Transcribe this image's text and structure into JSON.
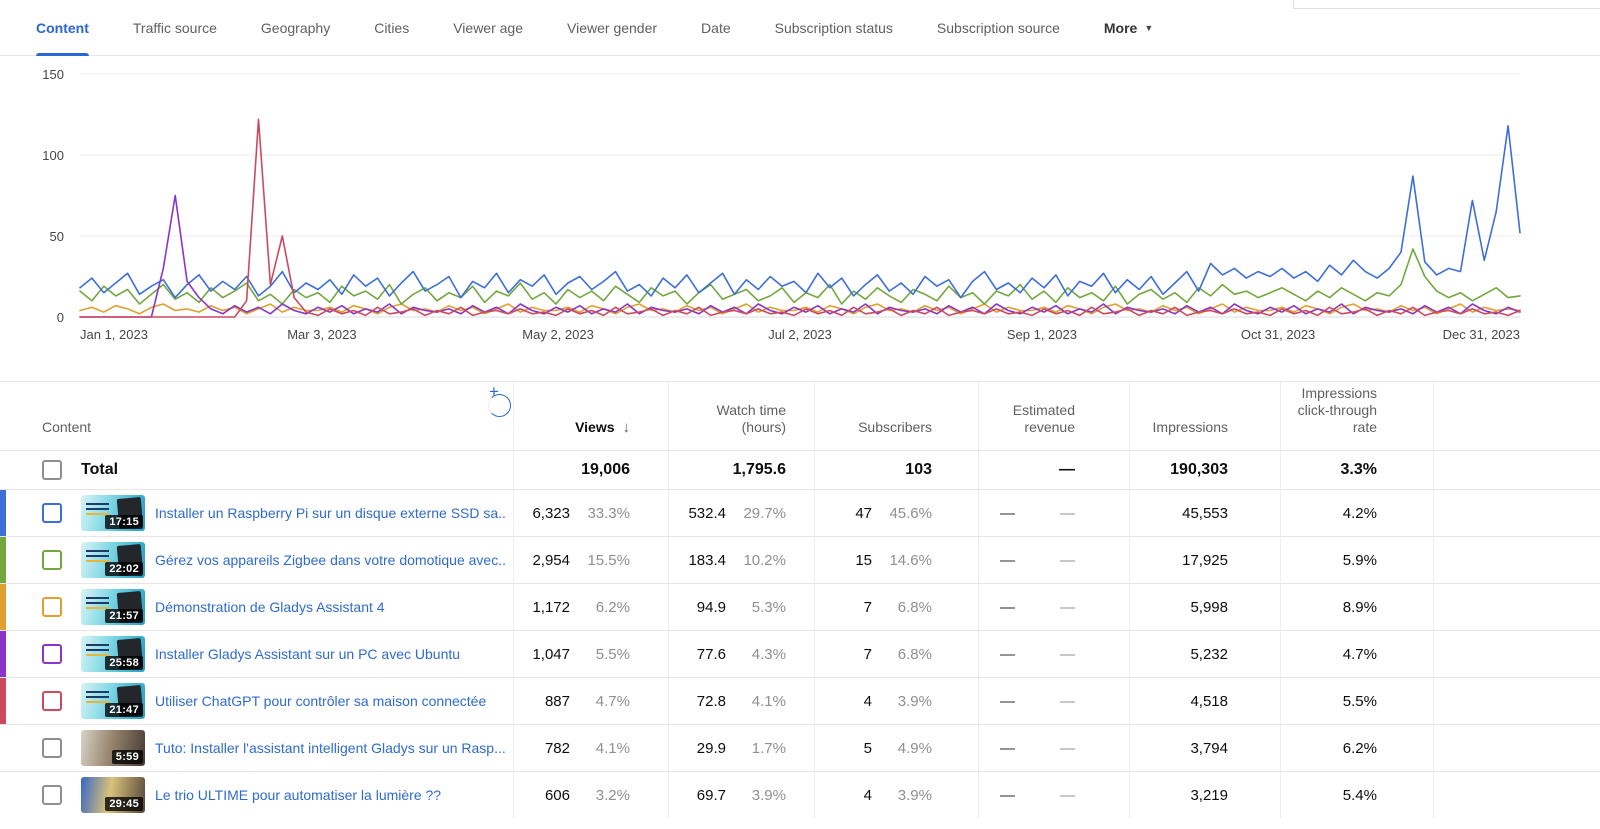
{
  "tabs": {
    "items": [
      {
        "label": "Content",
        "active": true
      },
      {
        "label": "Traffic source",
        "active": false
      },
      {
        "label": "Geography",
        "active": false
      },
      {
        "label": "Cities",
        "active": false
      },
      {
        "label": "Viewer age",
        "active": false
      },
      {
        "label": "Viewer gender",
        "active": false
      },
      {
        "label": "Date",
        "active": false
      },
      {
        "label": "Subscription status",
        "active": false
      },
      {
        "label": "Subscription source",
        "active": false
      }
    ],
    "more_label": "More"
  },
  "chart_data": {
    "type": "line",
    "title": "",
    "xlabel": "",
    "ylabel": "",
    "ylim": [
      0,
      150
    ],
    "grid": true,
    "legend": "none",
    "y_axis": {
      "max": 150,
      "ticks": [
        150,
        100,
        50,
        0
      ]
    },
    "x_axis": {
      "labels": [
        "Jan 1, 2023",
        "Mar 3, 2023",
        "May 2, 2023",
        "Jul 2, 2023",
        "Sep 1, 2023",
        "Oct 31, 2023",
        "Dec 31, 2023"
      ],
      "fractions": [
        0,
        0.168,
        0.332,
        0.5,
        0.668,
        0.832,
        1
      ]
    },
    "series": [
      {
        "name": "Démonstration de Gladys Assistant 4",
        "color": "#e0a030",
        "values": [
          4,
          6,
          3,
          7,
          5,
          2,
          6,
          8,
          4,
          5,
          3,
          7,
          4,
          6,
          2,
          5,
          8,
          3,
          6,
          4,
          4,
          6,
          3,
          7,
          5,
          2,
          6,
          8,
          4,
          5,
          3,
          7,
          4,
          6,
          2,
          5,
          8,
          3,
          6,
          4,
          4,
          6,
          3,
          7,
          5,
          2,
          6,
          8,
          4,
          5,
          3,
          7,
          4,
          6,
          2,
          5,
          8,
          3,
          6,
          4,
          4,
          6,
          3,
          7,
          5,
          2,
          6,
          8,
          4,
          5,
          3,
          7,
          4,
          6,
          2,
          5,
          8,
          3,
          6,
          4,
          4,
          6,
          3,
          7,
          5,
          2,
          6,
          8,
          4,
          5,
          3,
          7,
          4,
          6,
          2,
          5,
          8,
          3,
          6,
          4,
          4,
          6,
          3,
          7,
          5,
          2,
          6,
          8,
          4,
          5,
          3,
          7,
          4,
          6,
          2,
          5,
          8,
          3,
          6,
          4,
          5,
          4
        ]
      },
      {
        "name": "Gérez vos appareils Zigbee dans votre domotique avec...",
        "color": "#74a73e",
        "values": [
          16,
          10,
          19,
          13,
          17,
          8,
          14,
          20,
          11,
          15,
          9,
          18,
          12,
          16,
          21,
          10,
          14,
          8,
          17,
          12,
          15,
          9,
          19,
          13,
          16,
          11,
          20,
          8,
          14,
          18,
          10,
          15,
          12,
          19,
          9,
          16,
          13,
          21,
          11,
          15,
          8,
          17,
          12,
          16,
          10,
          19,
          14,
          9,
          18,
          13,
          16,
          8,
          15,
          20,
          11,
          14,
          17,
          10,
          13,
          18,
          9,
          15,
          12,
          20,
          8,
          16,
          11,
          18,
          13,
          9,
          17,
          14,
          10,
          19,
          12,
          15,
          8,
          16,
          13,
          20,
          11,
          16,
          9,
          18,
          12,
          15,
          10,
          19,
          8,
          14,
          17,
          11,
          15,
          9,
          18,
          13,
          20,
          14,
          16,
          12,
          15,
          18,
          14,
          10,
          16,
          12,
          18,
          14,
          10,
          15,
          13,
          20,
          42,
          25,
          16,
          12,
          15,
          10,
          14,
          18,
          12,
          13
        ]
      },
      {
        "name": "Installer un Raspberry Pi sur un disque externe SSD sa...",
        "color": "#3e6fd7",
        "values": [
          18,
          24,
          15,
          21,
          27,
          14,
          19,
          23,
          12,
          20,
          26,
          16,
          22,
          17,
          25,
          13,
          19,
          28,
          15,
          21,
          17,
          23,
          14,
          26,
          19,
          24,
          13,
          21,
          28,
          16,
          20,
          25,
          12,
          22,
          18,
          27,
          15,
          23,
          19,
          26,
          14,
          21,
          25,
          17,
          22,
          28,
          16,
          20,
          13,
          24,
          18,
          26,
          15,
          21,
          27,
          14,
          23,
          17,
          25,
          19,
          22,
          15,
          27,
          18,
          24,
          13,
          20,
          26,
          16,
          21,
          14,
          25,
          19,
          23,
          12,
          22,
          28,
          17,
          21,
          15,
          24,
          18,
          26,
          13,
          22,
          19,
          27,
          15,
          23,
          17,
          25,
          14,
          21,
          28,
          16,
          33,
          26,
          30,
          24,
          28,
          25,
          30,
          24,
          28,
          22,
          32,
          26,
          35,
          28,
          24,
          30,
          40,
          87,
          34,
          26,
          30,
          28,
          72,
          35,
          65,
          118,
          52
        ]
      },
      {
        "name": "Installer Gladys Assistant sur un PC avec Ubuntu",
        "color": "#8a35c8",
        "values": [
          0,
          0,
          0,
          0,
          0,
          0,
          0,
          30,
          75,
          22,
          12,
          5,
          2,
          7,
          3,
          6,
          2,
          8,
          4,
          2,
          6,
          3,
          7,
          2,
          5,
          3,
          8,
          2,
          6,
          4,
          3,
          5,
          2,
          7,
          3,
          6,
          2,
          8,
          4,
          2,
          6,
          3,
          7,
          2,
          5,
          3,
          8,
          2,
          6,
          4,
          3,
          5,
          2,
          7,
          3,
          6,
          2,
          8,
          4,
          2,
          6,
          3,
          7,
          2,
          5,
          3,
          8,
          2,
          6,
          4,
          3,
          5,
          2,
          7,
          3,
          6,
          2,
          8,
          4,
          2,
          6,
          3,
          7,
          2,
          5,
          3,
          8,
          2,
          6,
          4,
          3,
          5,
          2,
          7,
          3,
          6,
          2,
          8,
          4,
          2,
          6,
          3,
          7,
          2,
          5,
          3,
          8,
          2,
          6,
          4,
          3,
          5,
          2,
          7,
          3,
          6,
          2,
          8,
          4,
          2,
          6,
          3
        ]
      },
      {
        "name": "Utiliser ChatGPT pour contrôler sa maison connectée",
        "color": "#cc4a5e",
        "values": [
          0,
          0,
          0,
          0,
          0,
          0,
          0,
          0,
          0,
          0,
          0,
          0,
          0,
          0,
          10,
          122,
          20,
          50,
          12,
          3,
          1,
          5,
          2,
          4,
          1,
          6,
          2,
          3,
          5,
          1,
          4,
          2,
          6,
          1,
          3,
          4,
          2,
          5,
          2,
          3,
          1,
          5,
          2,
          4,
          1,
          6,
          2,
          3,
          5,
          1,
          4,
          2,
          6,
          1,
          3,
          4,
          2,
          5,
          2,
          3,
          1,
          5,
          2,
          4,
          1,
          6,
          2,
          3,
          5,
          1,
          4,
          2,
          6,
          1,
          3,
          4,
          2,
          5,
          2,
          3,
          1,
          5,
          2,
          4,
          1,
          6,
          2,
          3,
          5,
          1,
          4,
          2,
          6,
          1,
          3,
          4,
          2,
          5,
          2,
          3,
          1,
          5,
          2,
          4,
          1,
          6,
          2,
          3,
          5,
          1,
          4,
          2,
          6,
          1,
          3,
          4,
          2,
          5,
          2,
          3,
          1,
          4
        ]
      }
    ]
  },
  "table": {
    "columns": {
      "content": "Content",
      "views": "Views",
      "watch": "Watch time\n(hours)",
      "subscribers": "Subscribers",
      "revenue": "Estimated\nrevenue",
      "impressions": "Impressions",
      "ctr": "Impressions\nclick-through\nrate"
    },
    "sort_icon": "down-arrow",
    "total": {
      "label": "Total",
      "views": "19,006",
      "watch": "1,795.6",
      "subscribers": "103",
      "revenue": "—",
      "impressions": "190,303",
      "ctr": "3.3%"
    },
    "rows": [
      {
        "color": "#3e6fd7",
        "duration": "17:15",
        "title": "Installer un Raspberry Pi sur un disque externe SSD sa...",
        "views": "6,323",
        "views_pct": "33.3%",
        "watch": "532.4",
        "watch_pct": "29.7%",
        "subscribers": "47",
        "subscribers_pct": "45.6%",
        "revenue": "—",
        "revenue_pct": "—",
        "impressions": "45,553",
        "ctr": "4.2%"
      },
      {
        "color": "#74a73e",
        "duration": "22:02",
        "title": "Gérez vos appareils Zigbee dans votre domotique avec...",
        "views": "2,954",
        "views_pct": "15.5%",
        "watch": "183.4",
        "watch_pct": "10.2%",
        "subscribers": "15",
        "subscribers_pct": "14.6%",
        "revenue": "—",
        "revenue_pct": "—",
        "impressions": "17,925",
        "ctr": "5.9%"
      },
      {
        "color": "#e0a030",
        "duration": "21:57",
        "title": "Démonstration de Gladys Assistant 4",
        "views": "1,172",
        "views_pct": "6.2%",
        "watch": "94.9",
        "watch_pct": "5.3%",
        "subscribers": "7",
        "subscribers_pct": "6.8%",
        "revenue": "—",
        "revenue_pct": "—",
        "impressions": "5,998",
        "ctr": "8.9%"
      },
      {
        "color": "#8a35c8",
        "duration": "25:58",
        "title": "Installer Gladys Assistant sur un PC avec Ubuntu",
        "views": "1,047",
        "views_pct": "5.5%",
        "watch": "77.6",
        "watch_pct": "4.3%",
        "subscribers": "7",
        "subscribers_pct": "6.8%",
        "revenue": "—",
        "revenue_pct": "—",
        "impressions": "5,232",
        "ctr": "4.7%"
      },
      {
        "color": "#cc4a5e",
        "duration": "21:47",
        "title": "Utiliser ChatGPT pour contrôler sa maison connectée",
        "views": "887",
        "views_pct": "4.7%",
        "watch": "72.8",
        "watch_pct": "4.1%",
        "subscribers": "4",
        "subscribers_pct": "3.9%",
        "revenue": "—",
        "revenue_pct": "—",
        "impressions": "4,518",
        "ctr": "5.5%"
      },
      {
        "color": null,
        "duration": "5:59",
        "title": "Tuto: Installer l'assistant intelligent Gladys sur un Rasp...",
        "views": "782",
        "views_pct": "4.1%",
        "watch": "29.9",
        "watch_pct": "1.7%",
        "subscribers": "5",
        "subscribers_pct": "4.9%",
        "revenue": "—",
        "revenue_pct": "—",
        "impressions": "3,794",
        "ctr": "6.2%"
      },
      {
        "color": null,
        "duration": "29:45",
        "title": "Le trio ULTIME pour automatiser la lumière ??",
        "views": "606",
        "views_pct": "3.2%",
        "watch": "69.7",
        "watch_pct": "3.9%",
        "subscribers": "4",
        "subscribers_pct": "3.9%",
        "revenue": "—",
        "revenue_pct": "—",
        "impressions": "3,219",
        "ctr": "5.4%"
      }
    ]
  }
}
